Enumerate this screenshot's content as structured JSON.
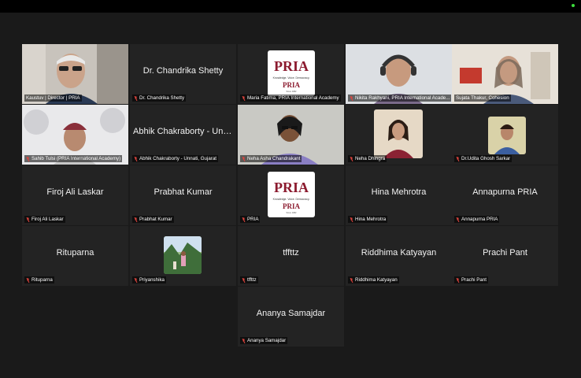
{
  "colors": {
    "background": "#1a1a1a",
    "tile": "#232323",
    "active_border": "#3ddc3d",
    "mute_red": "#e0443e",
    "brand": "#8b1a2e"
  },
  "logo": {
    "text_top": "PRIA",
    "tagline": "Knowledge. Voice. Democracy.",
    "brand": "PRIA",
    "since": "Since 1982"
  },
  "participants": [
    {
      "name": "Kaustuv | Director | PRIA",
      "display": ""
    },
    {
      "name": "Dr. Chandrika Shetty",
      "display": "Dr. Chandrika Shetty"
    },
    {
      "name": "Maria Fatima, PRIA International Academy",
      "display": ""
    },
    {
      "name": "Nikita Rakhyani, PRIA International Acade...",
      "display": ""
    },
    {
      "name": "Sujata Thakur, Cohesion",
      "display": ""
    },
    {
      "name": "Sahib Tulsi (PRIA International Academy)",
      "display": ""
    },
    {
      "name": "Abhik Chakraborty - Unnati, Gujarat",
      "display": "Abhik Chakraborty - Unna..."
    },
    {
      "name": "Neha Asha Chandrakant",
      "display": ""
    },
    {
      "name": "Neha Dhingra",
      "display": ""
    },
    {
      "name": "Dr.Udita Ghosh Sarkar",
      "display": ""
    },
    {
      "name": "Firoj Ali Laskar",
      "display": "Firoj Ali Laskar"
    },
    {
      "name": "Prabhat Kumar",
      "display": "Prabhat Kumar"
    },
    {
      "name": "PRIA",
      "display": ""
    },
    {
      "name": "Hina Mehrotra",
      "display": "Hina Mehrotra"
    },
    {
      "name": "Annapurna PRIA",
      "display": "Annapurna PRIA"
    },
    {
      "name": "Rituparna",
      "display": "Rituparna"
    },
    {
      "name": "Priyanshika",
      "display": ""
    },
    {
      "name": "tffttz",
      "display": "tffttz"
    },
    {
      "name": "Riddhima Katyayan",
      "display": "Riddhima Katyayan"
    },
    {
      "name": "Prachi Pant",
      "display": "Prachi Pant"
    },
    {
      "name": "Ananya Samajdar",
      "display": "Ananya Samajdar"
    }
  ]
}
